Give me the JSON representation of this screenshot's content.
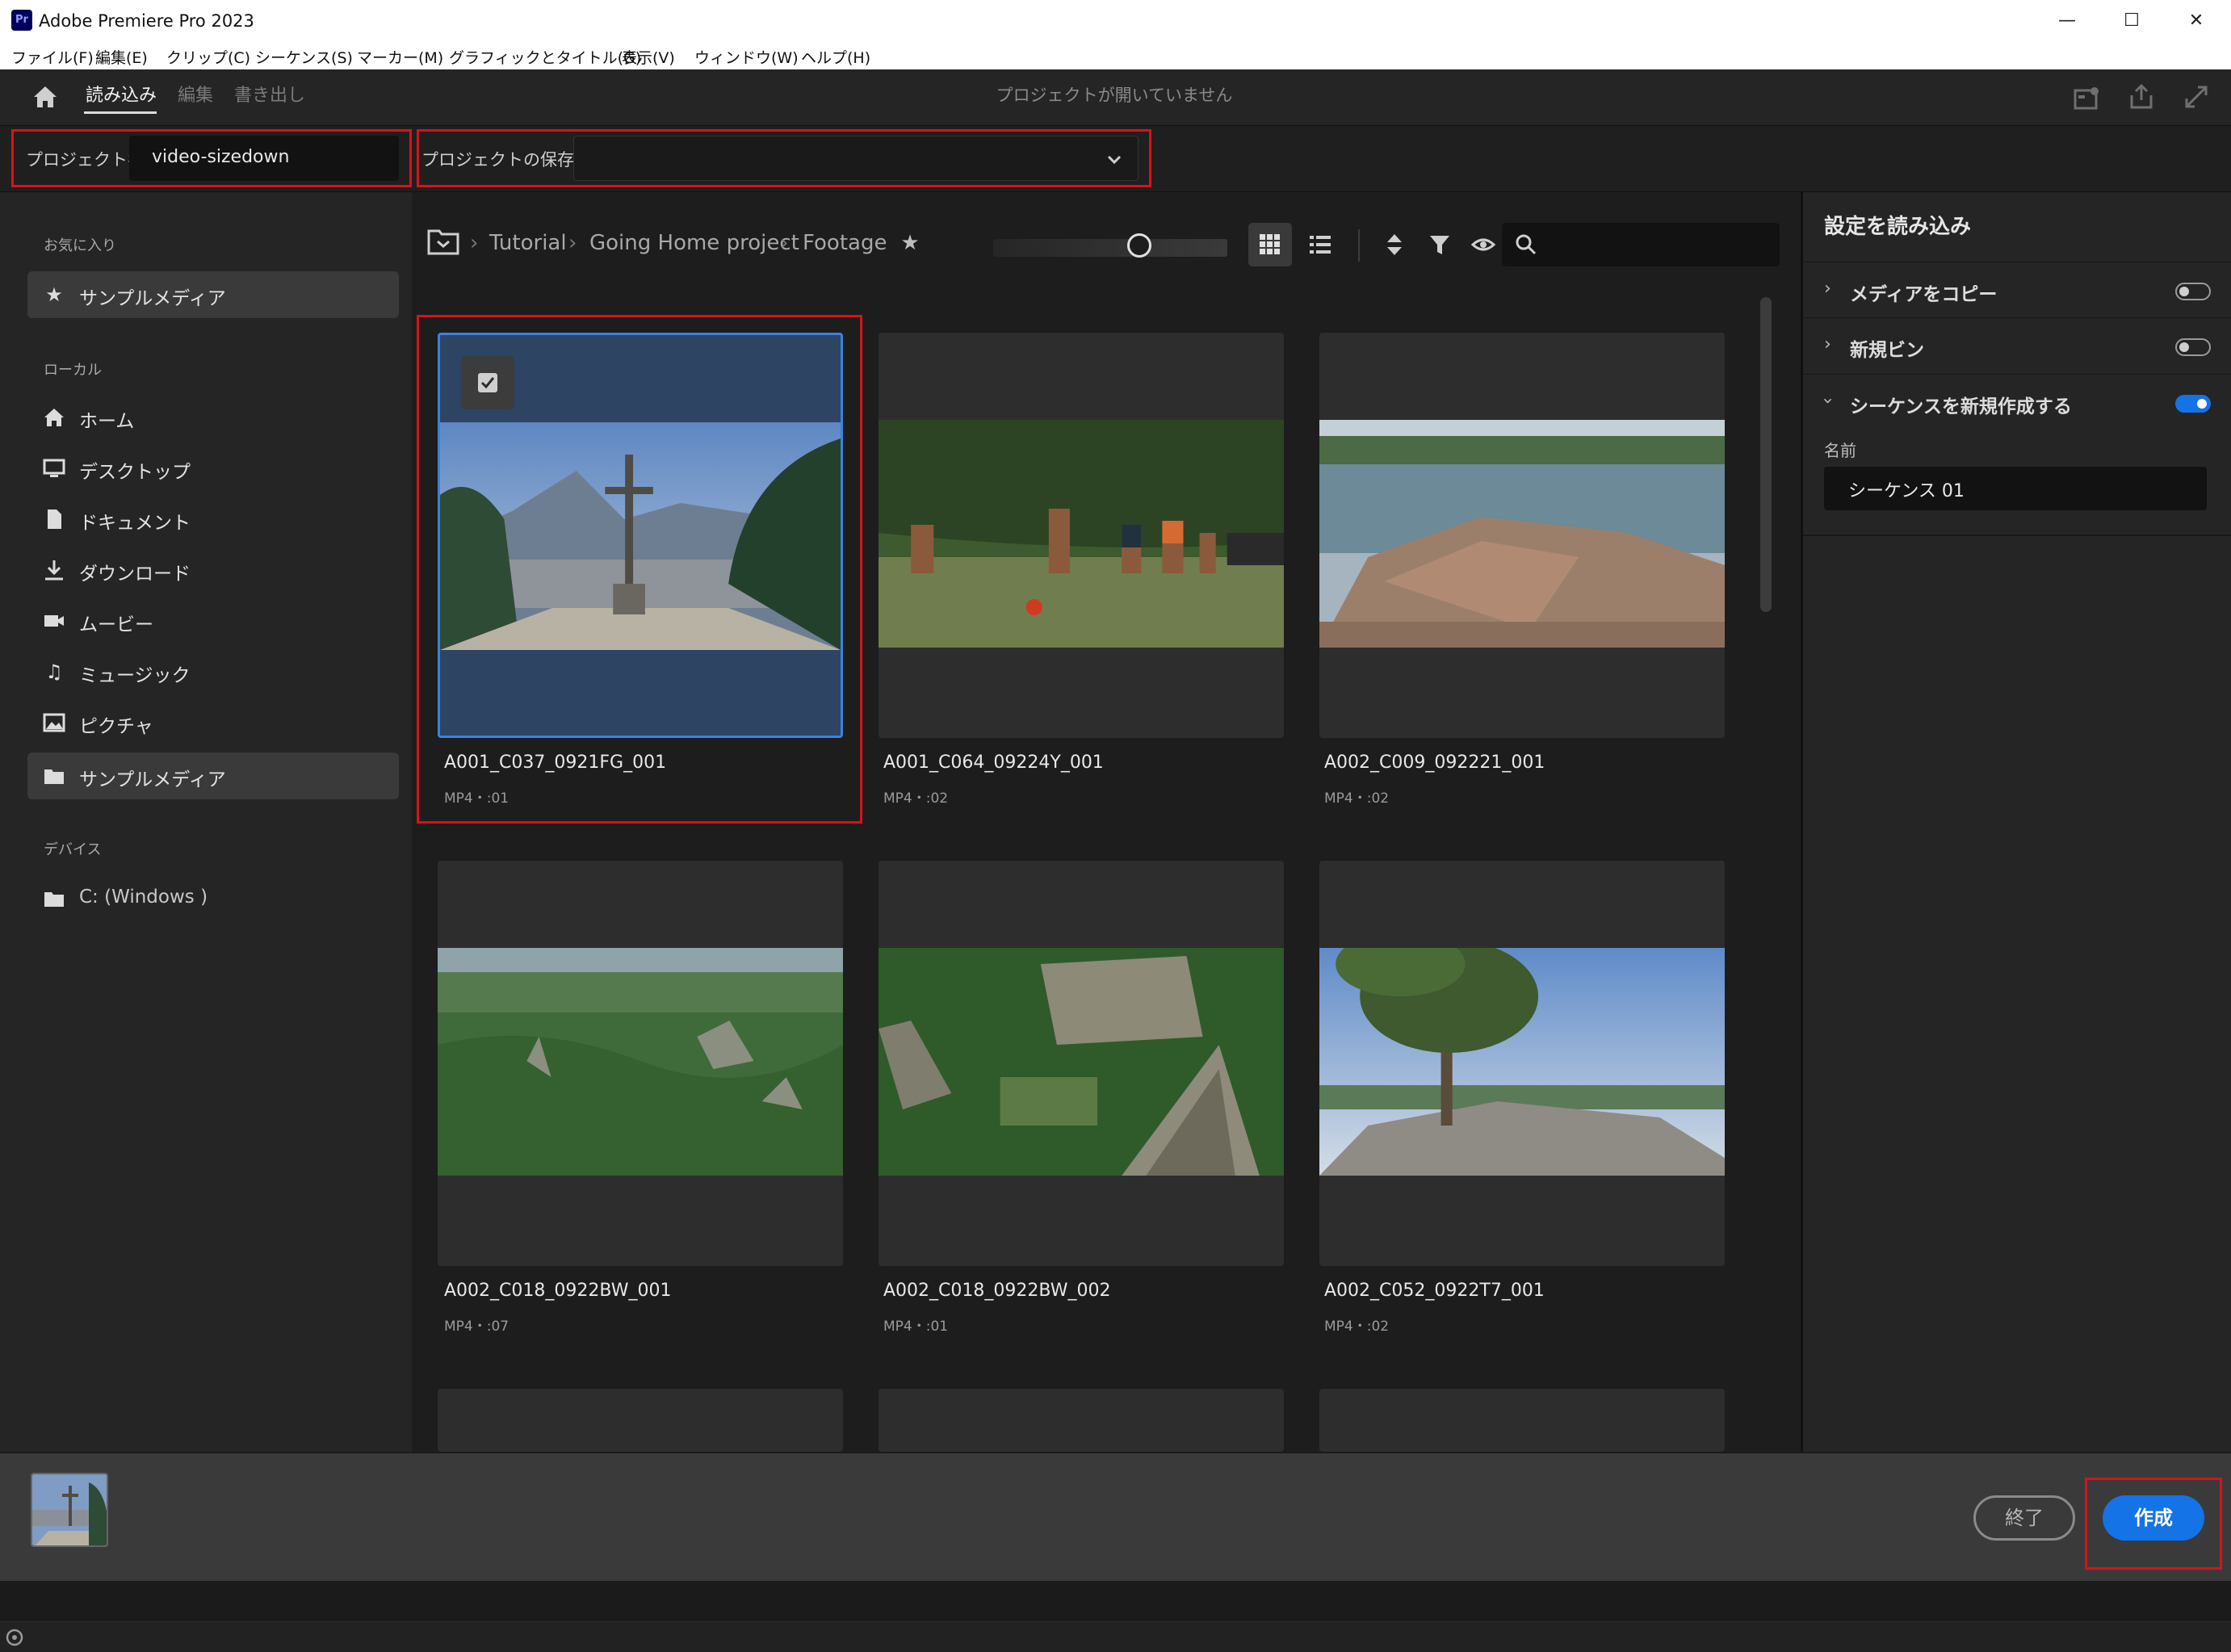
{
  "window": {
    "title": "Adobe Premiere Pro 2023",
    "logo_text": "Pr",
    "minimize": "—",
    "maximize": "☐",
    "close": "✕"
  },
  "menu": [
    "ファイル(F)",
    "編集(E)",
    "クリップ(C)",
    "シーケンス(S)",
    "マーカー(M)",
    "グラフィックとタイトル(G)",
    "表示(V)",
    "ウィンドウ(W)",
    "ヘルプ(H)"
  ],
  "header": {
    "tabs": [
      "読み込み",
      "編集",
      "書き出し"
    ],
    "status": "プロジェクトが開いていません"
  },
  "project": {
    "name_label": "プロジェクト名",
    "name_value": "video-sizedown",
    "location_label": "プロジェクトの保存先",
    "location_value": ""
  },
  "sidebar": {
    "favorites_label": "お気に入り",
    "favorites": [
      {
        "label": "サンプルメディア",
        "icon": "star-icon"
      }
    ],
    "local_label": "ローカル",
    "local": [
      {
        "label": "ホーム",
        "icon": "home-icon"
      },
      {
        "label": "デスクトップ",
        "icon": "desktop-icon"
      },
      {
        "label": "ドキュメント",
        "icon": "document-icon"
      },
      {
        "label": "ダウンロード",
        "icon": "download-icon"
      },
      {
        "label": "ムービー",
        "icon": "movie-icon"
      },
      {
        "label": "ミュージック",
        "icon": "music-icon"
      },
      {
        "label": "ピクチャ",
        "icon": "picture-icon"
      },
      {
        "label": "サンプルメディア",
        "icon": "folder-icon"
      }
    ],
    "devices_label": "デバイス",
    "devices": [
      {
        "label": "C: (Windows )",
        "icon": "folder-icon"
      }
    ]
  },
  "breadcrumb": [
    "Tutorial",
    "Going Home project",
    "Footage"
  ],
  "media": [
    {
      "name": "A001_C037_0921FG_001",
      "meta": "MP4・:01",
      "selected": true
    },
    {
      "name": "A001_C064_09224Y_001",
      "meta": "MP4・:02",
      "selected": false
    },
    {
      "name": "A002_C009_092221_001",
      "meta": "MP4・:02",
      "selected": false
    },
    {
      "name": "A002_C018_0922BW_001",
      "meta": "MP4・:07",
      "selected": false
    },
    {
      "name": "A002_C018_0922BW_002",
      "meta": "MP4・:01",
      "selected": false
    },
    {
      "name": "A002_C052_0922T7_001",
      "meta": "MP4・:02",
      "selected": false
    }
  ],
  "import_settings": {
    "title": "設定を読み込み",
    "copy_media": {
      "label": "メディアをコピー",
      "on": false
    },
    "new_bin": {
      "label": "新規ビン",
      "on": false
    },
    "new_sequence": {
      "label": "シーケンスを新規作成する",
      "on": true
    },
    "name_label": "名前",
    "name_value": "シーケンス 01"
  },
  "footer": {
    "exit": "終了",
    "create": "作成"
  },
  "colors": {
    "accent": "#1473e6",
    "highlight": "#d8121a",
    "selection": "#2d4563"
  }
}
